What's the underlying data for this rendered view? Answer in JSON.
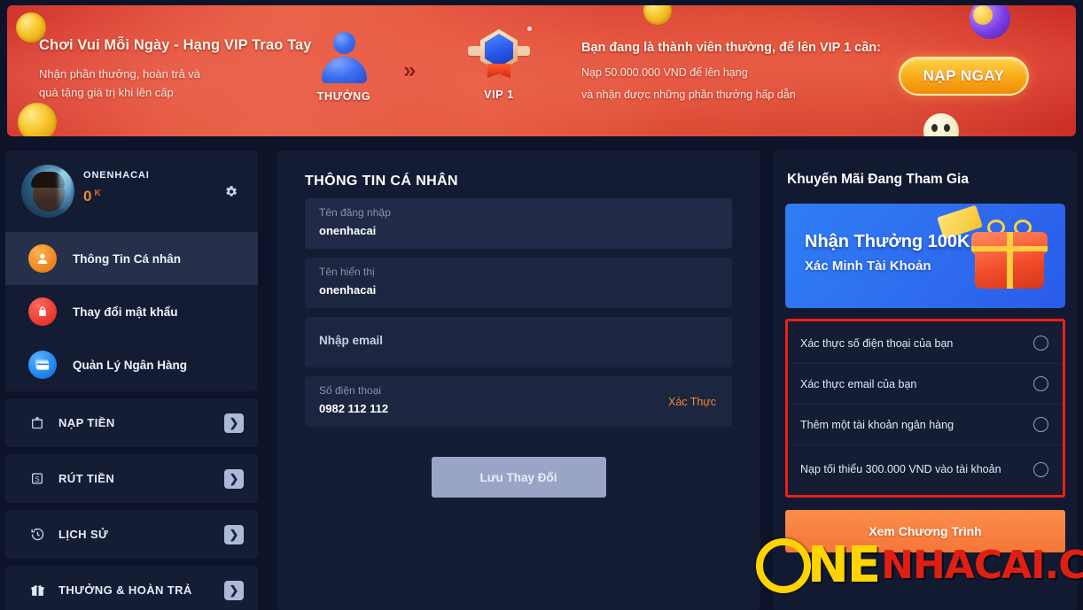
{
  "banner": {
    "title": "Chơi Vui Mỗi Ngày - Hạng VIP Trao Tay",
    "subtitle_line1": "Nhận phần thưởng, hoàn trả và",
    "subtitle_line2": "quà tặng giá trị khi lên cấp",
    "step_current_label": "THƯỞNG",
    "step_next_label": "VIP 1",
    "arrow": "»",
    "right_heading": "Bạn đang là thành viên thường, để lên VIP 1 cần:",
    "right_line1": "Nạp 50.000.000 VND để lên hạng",
    "right_line2": "và nhận được những phần thưởng hấp dẫn",
    "cta_label": "NẠP NGAY"
  },
  "sidebar": {
    "username": "ONENHACAI",
    "balance_amount": "0",
    "balance_currency": "K",
    "nav": [
      {
        "label": "Thông Tin Cá nhân",
        "icon": "user-icon",
        "color": "orange",
        "active": true
      },
      {
        "label": "Thay đổi mật khẩu",
        "icon": "lock-icon",
        "color": "red",
        "active": false
      },
      {
        "label": "Quản Lý Ngân Hàng",
        "icon": "cards-icon",
        "color": "blue",
        "active": false
      }
    ],
    "links": [
      {
        "label": "NẠP TIỀN",
        "icon": "deposit-icon"
      },
      {
        "label": "RÚT TIỀN",
        "icon": "withdraw-icon"
      },
      {
        "label": "LỊCH SỬ",
        "icon": "history-icon"
      },
      {
        "label": "THƯỞNG & HOÀN TRẢ",
        "icon": "gift-icon"
      }
    ],
    "chevron": "❯"
  },
  "main": {
    "title": "THÔNG TIN CÁ NHÂN",
    "fields": [
      {
        "label": "Tên đăng nhập",
        "value": "onenhacai"
      },
      {
        "label": "Tên hiển thị",
        "value": "onenhacai"
      }
    ],
    "email_placeholder": "Nhập email",
    "phone_label": "Số điện thoại",
    "phone_value": "0982 112 112",
    "phone_action": "Xác Thực",
    "save_label": "Lưu Thay Đổi"
  },
  "promotions": {
    "title": "Khuyến Mãi Đang Tham Gia",
    "card_title": "Nhận Thưởng 100K",
    "card_subtitle": "Xác Minh Tài Khoản",
    "tasks": [
      "Xác thực số điện thoại của bạn",
      "Xác thực email của bạn",
      "Thêm một tài khoản ngân hàng",
      "Nạp tối thiểu 300.000 VND vào tài khoản"
    ],
    "view_label": "Xem Chương Trình"
  },
  "watermark": {
    "brand_one": "NE",
    "brand_domain": "NHACAI.COM"
  },
  "colors": {
    "banner_red": "#d2352c",
    "cta_gold": "#f9a914",
    "accent_orange": "#f08a2b",
    "task_border_red": "#ef1f17",
    "promo_blue": "#2f7ef5",
    "panel_bg": "#141c33",
    "page_bg": "#0d1328"
  }
}
